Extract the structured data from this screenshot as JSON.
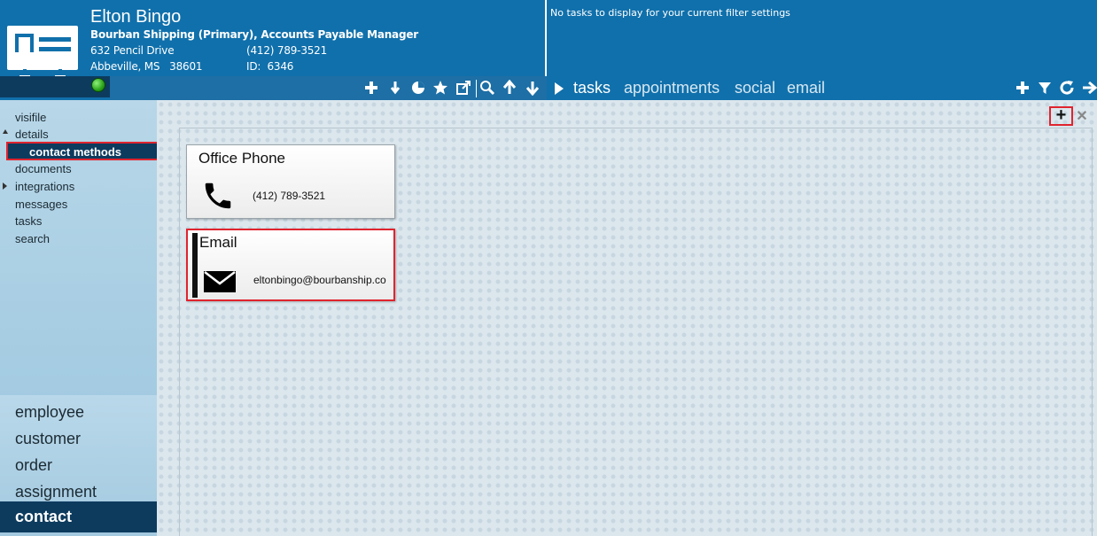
{
  "header": {
    "name": "Elton Bingo",
    "company_line": "Bourban Shipping  (Primary), Accounts Payable Manager",
    "address1": "632 Pencil Drive",
    "phone": "(412) 789-3521",
    "address2": "Abbeville, MS   38601",
    "id_label": "ID:  6346",
    "status_color": "#2aa21a"
  },
  "tasks_panel": {
    "message": "No tasks to display for your current filter settings",
    "tabs": [
      "tasks",
      "appointments",
      "social",
      "email"
    ]
  },
  "toolbar_left": [
    "add-icon",
    "drop-icon",
    "pie-icon",
    "star-icon",
    "export-icon",
    "search-icon",
    "up-arrow-icon",
    "down-arrow-icon"
  ],
  "toolbar_right": [
    "add-icon",
    "filter-icon",
    "refresh-icon",
    "forward-arrow-icon"
  ],
  "sidebar": {
    "items": [
      "visifile",
      "details",
      "contact methods",
      "documents",
      "integrations",
      "messages",
      "tasks",
      "search"
    ],
    "modules": [
      "employee",
      "customer",
      "order",
      "assignment",
      "contact"
    ]
  },
  "contact_methods": [
    {
      "title": "Office Phone",
      "value": "(412) 789-3521",
      "icon": "phone-icon"
    },
    {
      "title": "Email",
      "value": "eltonbingo@bourbanship.co",
      "icon": "envelope-icon"
    }
  ],
  "colors": {
    "header_blue": "#1070ab",
    "dark_navy": "#0d3b5e",
    "highlight_red": "#e0242e"
  }
}
